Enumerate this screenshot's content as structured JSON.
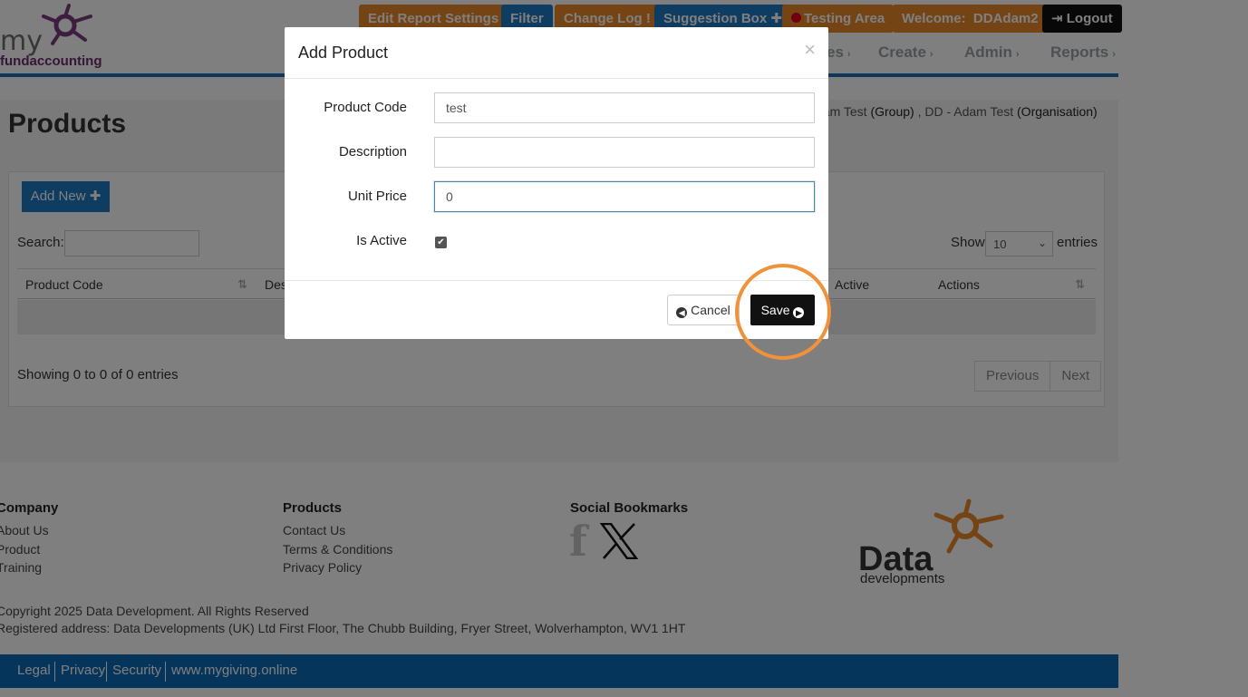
{
  "header": {
    "logo_my": "my",
    "logo_fund": "fundaccounting",
    "buttons": {
      "edit_report": "Edit Report Settings",
      "filter": "Filter",
      "change_log": "Change Log",
      "change_log_mark": "!",
      "suggestion_box": "Suggestion Box",
      "testing_area": "Testing Area",
      "welcome_prefix": "Welcome:",
      "welcome_user": "DDAdam2",
      "logout": "Logout"
    },
    "nav": {
      "partial": "es",
      "create": "Create",
      "admin": "Admin",
      "reports": "Reports"
    },
    "colors": {
      "accent_blue": "#1f7ac4",
      "accent_orange": "#e8892a",
      "dark": "#111111"
    }
  },
  "page": {
    "title": "Products",
    "breadcrumb_1": "dam Test",
    "breadcrumb_1_type": "(Group)",
    "breadcrumb_sep": ",",
    "breadcrumb_2": "DD - Adam Test",
    "breadcrumb_2_type": "(Organisation)",
    "add_new": "Add New",
    "search_label": "Search:",
    "show_label": "Show",
    "page_size": "10",
    "entries_label": "entries",
    "columns": [
      "Product Code",
      "Des",
      "Active",
      "Actions"
    ],
    "showing": "Showing 0 to 0 of 0 entries",
    "previous": "Previous",
    "next": "Next"
  },
  "footer": {
    "company_title": "Company",
    "company_links": [
      "About Us",
      "Product",
      "Training"
    ],
    "products_title": "Products",
    "products_links": [
      "Contact Us",
      "Terms & Conditions",
      "Privacy Policy"
    ],
    "social_title": "Social Bookmarks",
    "social_facebook": "f",
    "copyright": "Copyright 2025 Data Development. All Rights Reserved",
    "address": "Registered address: Data Developments (UK) Ltd First Floor, The Chubb Building, Fryer Street, Wolverhampton, WV1 1HT",
    "dd_logo_data": "Data",
    "dd_logo_dev": "developments",
    "bottom_links": [
      "Legal",
      "Privacy",
      "Security",
      "www.mygiving.online"
    ]
  },
  "modal": {
    "title": "Add Product",
    "close": "×",
    "product_code_label": "Product Code",
    "product_code_value": "test",
    "description_label": "Description",
    "description_value": "",
    "unit_price_label": "Unit Price",
    "unit_price_value": "0",
    "is_active_label": "Is Active",
    "is_active_checked": true,
    "cancel": "Cancel",
    "save": "Save"
  }
}
